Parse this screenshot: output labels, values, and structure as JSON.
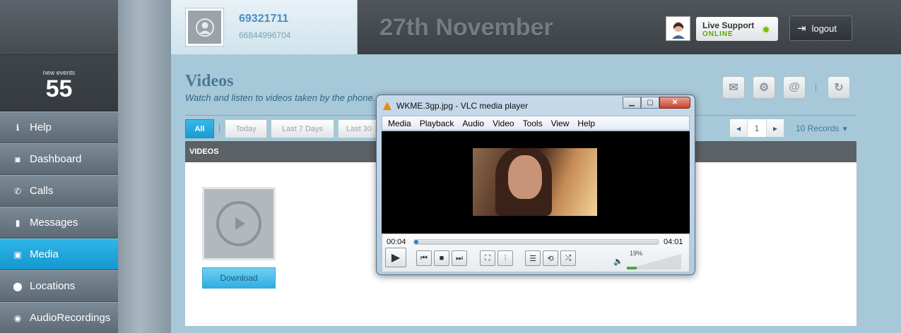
{
  "sidebar": {
    "events_label": "new events",
    "events_count": "55",
    "items": [
      {
        "label": "Help",
        "icon": "info-icon"
      },
      {
        "label": "Dashboard",
        "icon": "camera-icon"
      },
      {
        "label": "Calls",
        "icon": "phone-icon"
      },
      {
        "label": "Messages",
        "icon": "chat-icon"
      },
      {
        "label": "Media",
        "icon": "image-icon",
        "active": true
      },
      {
        "label": "Locations",
        "icon": "map-pin-icon"
      },
      {
        "label": "AudioRecordings",
        "icon": "microphone-icon"
      }
    ]
  },
  "header": {
    "profile_id": "69321711",
    "profile_number": "66844996704",
    "date": "27th November",
    "support_title": "Live Support",
    "support_status": "ONLINE",
    "logout_label": "logout"
  },
  "page": {
    "title": "Videos",
    "subtitle": "Watch and listen to videos taken by the phone.",
    "filters": [
      "All",
      "Today",
      "Last 7 Days",
      "Last 30"
    ],
    "active_filter": "All",
    "page_number": "1",
    "records_label": "10 Records",
    "section_title": "VIDEOS",
    "download_label": "Download"
  },
  "vlc": {
    "title": "WKME.3gp.jpg - VLC media player",
    "menu": [
      "Media",
      "Playback",
      "Audio",
      "Video",
      "Tools",
      "View",
      "Help"
    ],
    "time_elapsed": "00:04",
    "time_total": "04:01",
    "progress_fraction": 0.017,
    "volume": "19%"
  },
  "colors": {
    "accent": "#1ea3d8",
    "sidebar": "#5d6a74",
    "header": "#3c4146",
    "online": "#7ac300"
  }
}
